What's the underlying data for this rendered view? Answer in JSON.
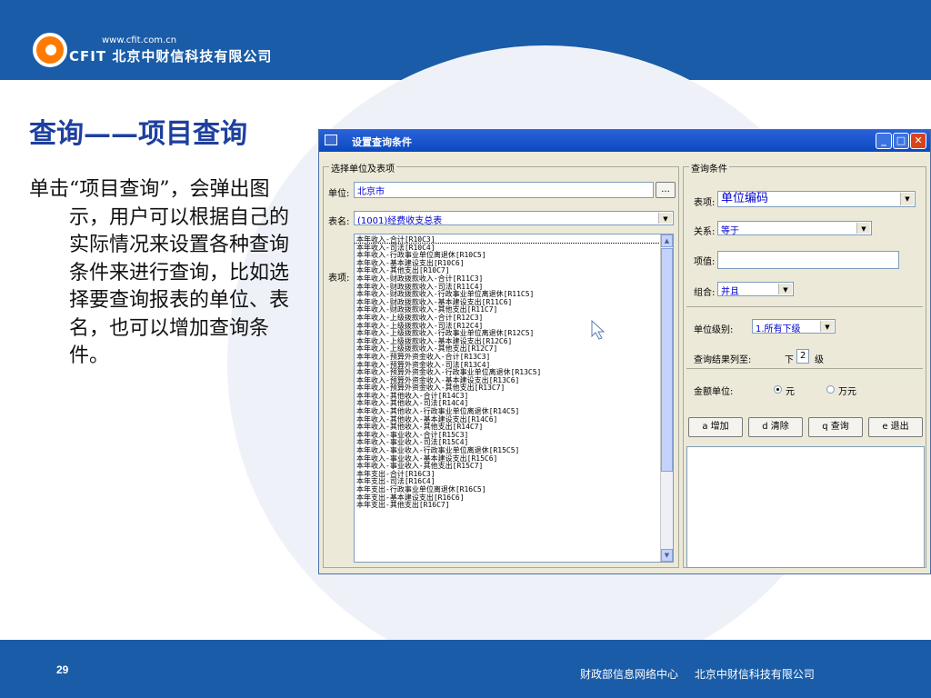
{
  "header": {
    "logo_url": "www.cfit.com.cn",
    "company": "北京中财信科技有限公司",
    "logo_mark": "CFIT"
  },
  "slide": {
    "title": "查询——项目查询",
    "body": "单击“项目查询”，会弹出图示，用户可以根据自己的实际情况来设置各种查询条件来进行查询，比如选择要查询报表的单位、表名，也可以增加查询条件。",
    "page_number": "29"
  },
  "footer": {
    "org1": "财政部信息网络中心",
    "org2": "北京中财信科技有限公司"
  },
  "dialog": {
    "title": "设置查询条件",
    "left_group": {
      "label": "选择单位及表项",
      "unit_label": "单位:",
      "unit_value": "北京市",
      "browse_label": "...",
      "table_label": "表名:",
      "table_value": "(1001)经费收支总表",
      "items_label": "表项:",
      "items": [
        "本年收入-合计[R10C3]",
        "本年收入-司法[R10C4]",
        "本年收入-行政事业单位离退休[R10C5]",
        "本年收入-基本建设支出[R10C6]",
        "本年收入-其他支出[R10C7]",
        "本年收入-财政拨款收入-合计[R11C3]",
        "本年收入-财政拨款收入-司法[R11C4]",
        "本年收入-财政拨款收入-行政事业单位离退休[R11C5]",
        "本年收入-财政拨款收入-基本建设支出[R11C6]",
        "本年收入-财政拨款收入-其他支出[R11C7]",
        "本年收入-上级拨款收入-合计[R12C3]",
        "本年收入-上级拨款收入-司法[R12C4]",
        "本年收入-上级拨款收入-行政事业单位离退休[R12C5]",
        "本年收入-上级拨款收入-基本建设支出[R12C6]",
        "本年收入-上级拨款收入-其他支出[R12C7]",
        "本年收入-预算外资金收入-合计[R13C3]",
        "本年收入-预算外资金收入-司法[R13C4]",
        "本年收入-预算外资金收入-行政事业单位离退休[R13C5]",
        "本年收入-预算外资金收入-基本建设支出[R13C6]",
        "本年收入-预算外资金收入-其他支出[R13C7]",
        "本年收入-其他收入-合计[R14C3]",
        "本年收入-其他收入-司法[R14C4]",
        "本年收入-其他收入-行政事业单位离退休[R14C5]",
        "本年收入-其他收入-基本建设支出[R14C6]",
        "本年收入-其他收入-其他支出[R14C7]",
        "本年收入-事业收入-合计[R15C3]",
        "本年收入-事业收入-司法[R15C4]",
        "本年收入-事业收入-行政事业单位离退休[R15C5]",
        "本年收入-事业收入-基本建设支出[R15C6]",
        "本年收入-事业收入-其他支出[R15C7]",
        "本年支出-合计[R16C3]",
        "本年支出-司法[R16C4]",
        "本年支出-行政事业单位离退休[R16C5]",
        "本年支出-基本建设支出[R16C6]",
        "本年支出-其他支出[R16C7]"
      ]
    },
    "right_group": {
      "label": "查询条件",
      "item_label": "表项:",
      "item_value": "单位编码",
      "relation_label": "关系:",
      "relation_value": "等于",
      "value_label": "项值:",
      "value_value": "",
      "combine_label": "组合:",
      "combine_value": "并且",
      "level_label": "单位级别:",
      "level_value": "1.所有下级",
      "result_label": "查询结果列至:",
      "result_prefix": "下",
      "result_value": "2",
      "result_suffix": "级",
      "money_label": "金额单位:",
      "money_opt1": "元",
      "money_opt2": "万元",
      "money_selected": "元"
    },
    "buttons": {
      "add": "a 增加",
      "clear": "d 清除",
      "query": "q 查询",
      "exit": "e 退出"
    }
  }
}
